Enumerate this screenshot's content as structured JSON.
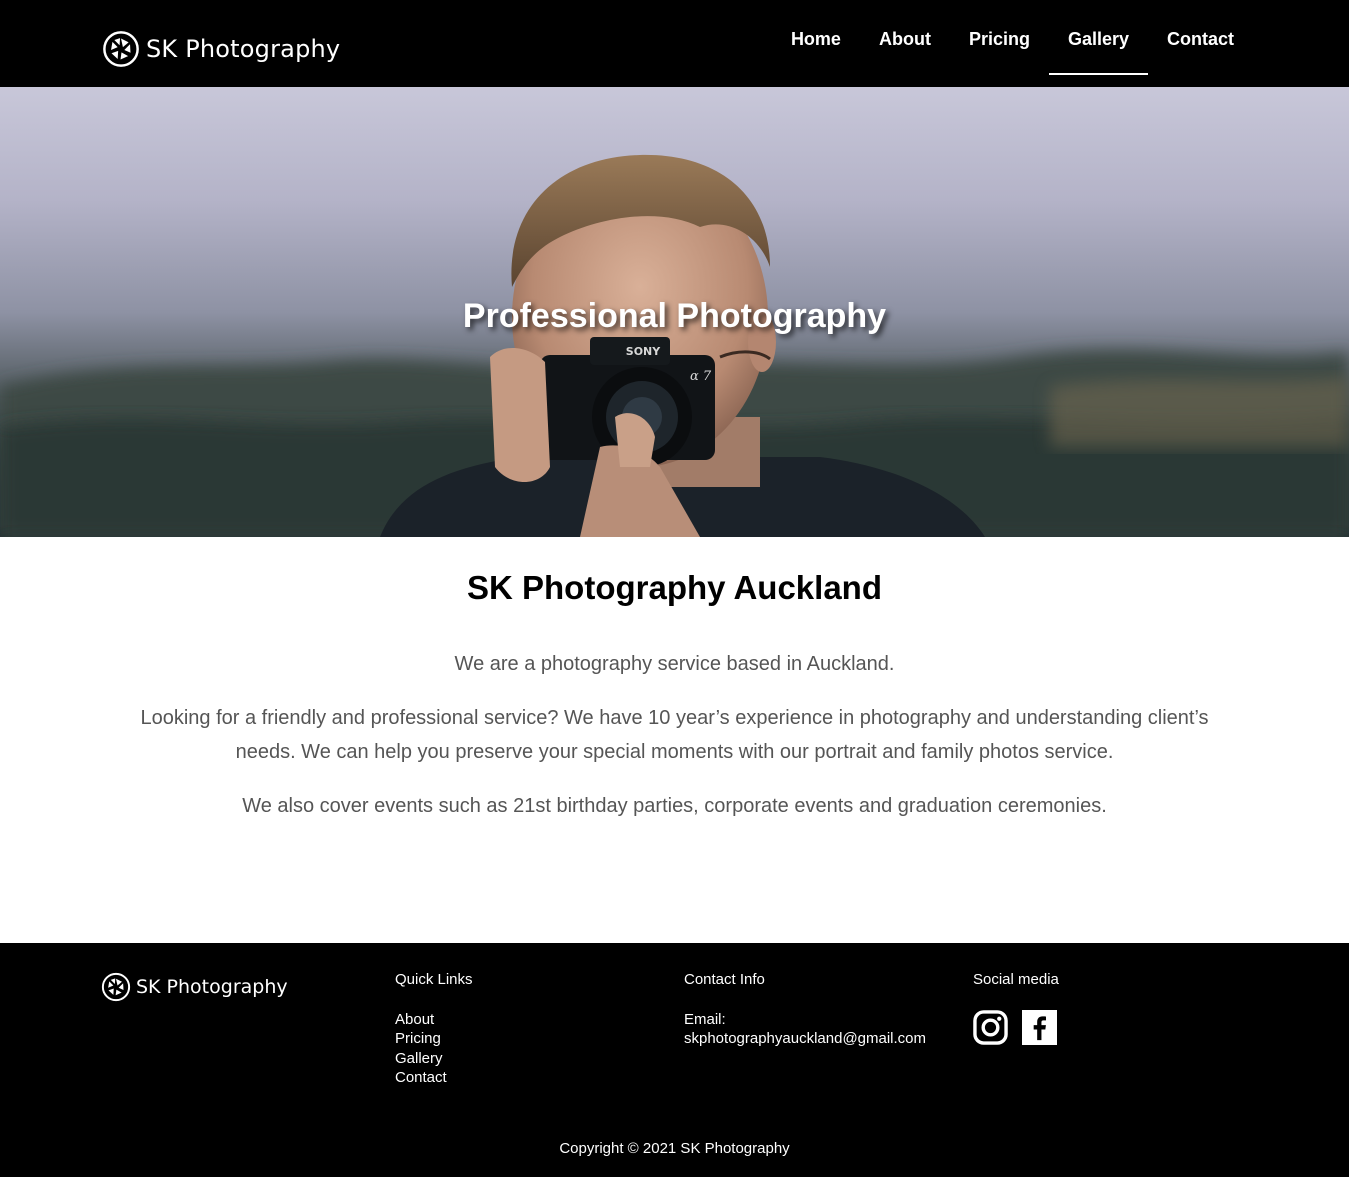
{
  "header": {
    "brand": "SK Photography",
    "nav": [
      {
        "label": "Home",
        "active": false
      },
      {
        "label": "About",
        "active": false
      },
      {
        "label": "Pricing",
        "active": false
      },
      {
        "label": "Gallery",
        "active": true
      },
      {
        "label": "Contact",
        "active": false
      }
    ]
  },
  "hero": {
    "title": "Professional Photography",
    "camera_brand": "SONY",
    "camera_model": "α 7",
    "image": "man-holding-camera-photo"
  },
  "intro": {
    "heading": "SK Photography Auckland",
    "paragraphs": [
      "We are a photography service based in Auckland.",
      "Looking for a friendly and professional service? We have 10 year’s experience in photography and understanding client’s needs. We can help you preserve your special moments with our portrait and family photos service.",
      "We also cover events such as 21st birthday parties, corporate events and graduation ceremonies."
    ]
  },
  "footer": {
    "brand": "SK Photography",
    "quick_links": {
      "title": "Quick Links",
      "items": [
        "About",
        "Pricing",
        "Gallery",
        "Contact"
      ]
    },
    "contact": {
      "title": "Contact Info",
      "email_label": "Email:",
      "email": "skphotographyauckland@gmail.com"
    },
    "social": {
      "title": "Social media",
      "icons": [
        "instagram-icon",
        "facebook-icon"
      ]
    },
    "copyright": "Copyright © 2021 SK Photography"
  },
  "colors": {
    "header_bg": "#000000",
    "footer_bg": "#000000",
    "body_text": "#555555",
    "heading_text": "#000000",
    "nav_text": "#ffffff"
  }
}
